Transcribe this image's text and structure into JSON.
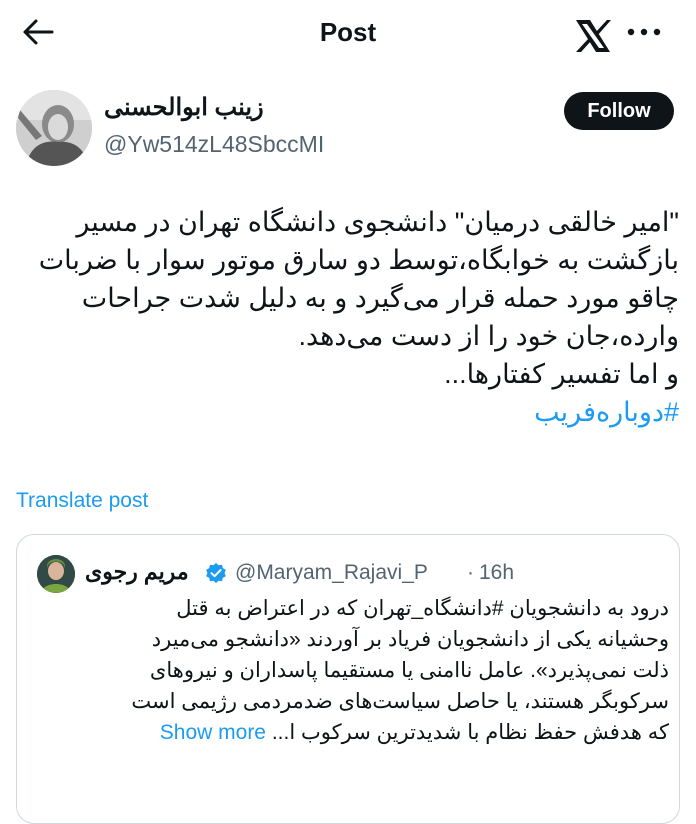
{
  "header": {
    "title": "Post",
    "back_icon": "arrow-left-icon",
    "logo_icon": "x-logo-icon",
    "more_icon": "more-horizontal-icon"
  },
  "author": {
    "display_name": "زینب ابوالحسنی",
    "handle": "@Yw514zL48SbccMI",
    "follow_label": "Follow"
  },
  "tweet": {
    "lines": [
      "\"امیر خالقی درمیان\" دانشجوی دانشگاه تهران در مسیر",
      "بازگشت به خوابگاه،توسط دو سارق موتور سوار با ضربات",
      "چاقو مورد حمله قرار می‌گیرد و به دلیل شدت جراحات",
      "وارده،جان خود را از دست می‌دهد.",
      "و اما تفسیر کفتارها..."
    ],
    "hashtag": "#دوباره‌فریب"
  },
  "translate_label": "Translate post",
  "quote": {
    "display_name": "مریم رجوی",
    "handle": "@Maryam_Rajavi_P",
    "separator": "·",
    "time": "16h",
    "lines": [
      "درود به دانشجویان #دانشگاه_تهران که در اعتراض به قتل",
      "وحشیانه یکی از دانشجویان فریاد بر آوردند «دانشجو می‌میرد",
      "ذلت نمی‌پذیرد». عامل ناامنی یا مستقیما پاسداران و نیروهای",
      "سرکوبگر هستند، یا حاصل سیاست‌های ضدمردمی رژیمی است",
      "که هدفش حفظ نظام با شدیدترین سرکوب ا..."
    ],
    "show_more_label": "Show more",
    "verified_icon": "verified-badge-icon"
  },
  "colors": {
    "link": "#1d9bf0",
    "text": "#0f1419",
    "secondary": "#536471",
    "border": "#cfd9de",
    "verified": "#1d9bf0"
  }
}
